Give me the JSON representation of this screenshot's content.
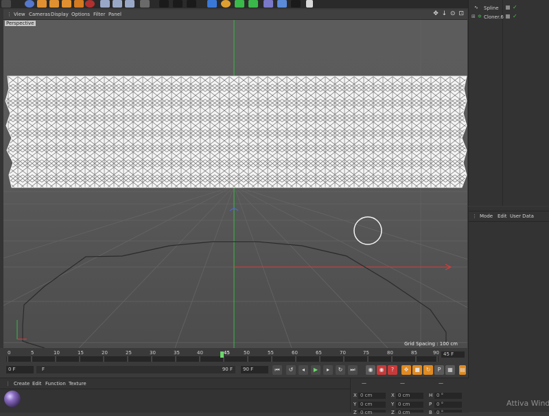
{
  "viewport": {
    "menu": [
      "View",
      "Cameras",
      "Display",
      "Options",
      "Filter",
      "Panel"
    ],
    "nav_icons": "✥ ↓ ⊙ ⊡",
    "camera_label": "Perspective",
    "grid_spacing": "Grid Spacing : 100 cm"
  },
  "object_manager": {
    "objects": [
      {
        "name": "Spline",
        "icon": "spline-icon"
      },
      {
        "name": "Cloner.6",
        "icon": "cloner-icon"
      }
    ]
  },
  "attribute_manager": {
    "menu": [
      "Mode",
      "Edit",
      "User Data"
    ],
    "watermark": "Attiva Wind"
  },
  "timeline": {
    "ticks": [
      "0",
      "5",
      "10",
      "15",
      "20",
      "25",
      "30",
      "35",
      "40",
      "45",
      "50",
      "55",
      "60",
      "65",
      "70",
      "75",
      "80",
      "85",
      "90"
    ],
    "current_frame_label": "45",
    "end_frame": "45 F"
  },
  "transport": {
    "start_field": "0 F",
    "range_start": "F",
    "range_end": "90 F",
    "end_field": "90 F"
  },
  "material_manager": {
    "menu": [
      "Create",
      "Edit",
      "Function",
      "Texture"
    ]
  },
  "coordinates": {
    "header": [
      "—",
      "—",
      "—"
    ],
    "rows": [
      {
        "a_label": "X",
        "a_value": "0 cm",
        "b_label": "X",
        "b_value": "0 cm",
        "c_label": "H",
        "c_value": "0 °"
      },
      {
        "a_label": "Y",
        "a_value": "0 cm",
        "b_label": "Y",
        "b_value": "0 cm",
        "c_label": "P",
        "c_value": "0 °"
      },
      {
        "a_label": "Z",
        "a_value": "0 cm",
        "b_label": "Z",
        "b_value": "0 cm",
        "c_label": "B",
        "c_value": "0 °"
      }
    ]
  },
  "colors": {
    "x_axis": "#e23a3a",
    "y_axis": "#3ab84a",
    "playhead": "#6bd96b",
    "record_button": "#c83a3a",
    "key_button": "#e08a20"
  }
}
